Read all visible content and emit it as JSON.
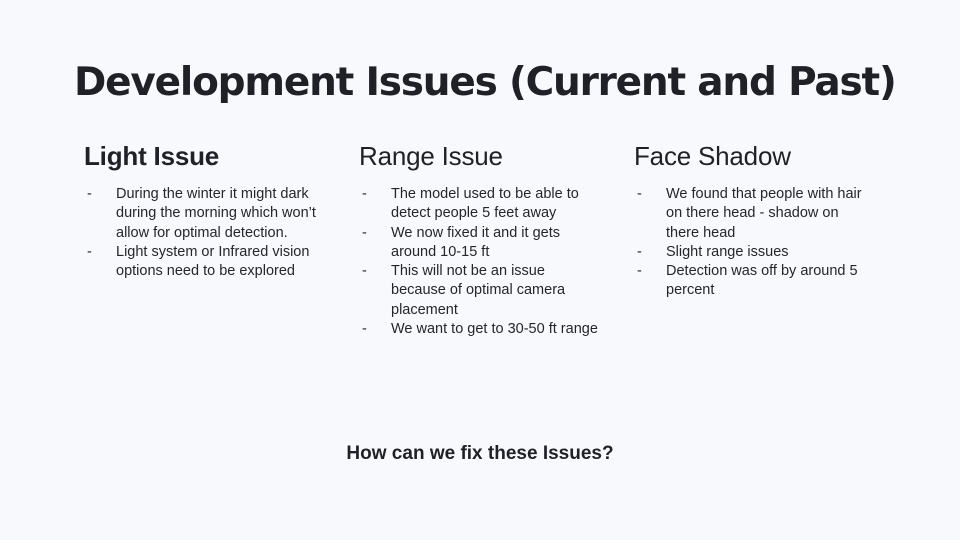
{
  "slide": {
    "title": "Development Issues (Current and Past)",
    "footer": "How can we fix these Issues?",
    "bullet_marker": "-"
  },
  "columns": [
    {
      "heading": "Light Issue",
      "bullets": [
        "During the winter it might dark during the morning which won’t allow for optimal detection.",
        "Light system or Infrared vision options need to be explored"
      ]
    },
    {
      "heading": "Range Issue",
      "bullets": [
        "The model used to be able to detect people 5 feet away",
        "We now fixed it and it gets around 10-15 ft",
        "This will not be an issue because of optimal camera placement",
        "We want to get to 30-50 ft range"
      ]
    },
    {
      "heading": "Face Shadow",
      "bullets": [
        "We found that people with hair on there head - shadow on there head",
        "Slight range issues",
        "Detection was off by around 5 percent"
      ]
    }
  ]
}
